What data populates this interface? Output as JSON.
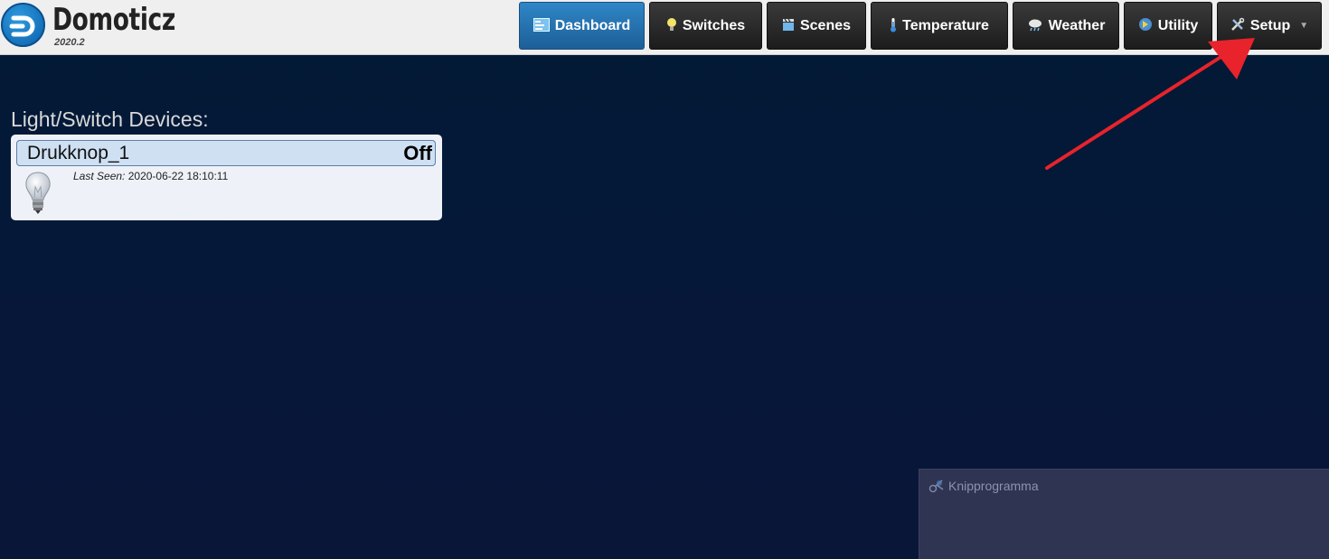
{
  "app": {
    "name": "Domoticz",
    "version": "2020.2"
  },
  "nav": {
    "items": [
      {
        "label": "Dashboard",
        "icon": "dashboard-icon",
        "active": true
      },
      {
        "label": "Switches",
        "icon": "lightbulb-icon",
        "active": false
      },
      {
        "label": "Scenes",
        "icon": "clapperboard-icon",
        "active": false
      },
      {
        "label": "Temperature",
        "icon": "thermometer-icon",
        "active": false
      },
      {
        "label": "Weather",
        "icon": "rain-cloud-icon",
        "active": false
      },
      {
        "label": "Utility",
        "icon": "utility-icon",
        "active": false
      },
      {
        "label": "Setup",
        "icon": "tools-icon",
        "active": false,
        "dropdown": true
      }
    ]
  },
  "content": {
    "section_title": "Light/Switch Devices:",
    "devices": [
      {
        "name": "Drukknop_1",
        "status": "Off",
        "last_seen_label": "Last Seen:",
        "last_seen_value": "2020-06-22 18:10:11",
        "icon": "lightbulb-off-icon"
      }
    ]
  },
  "overlay": {
    "snipping_tool_label": "Knipprogramma"
  },
  "colors": {
    "background": "#021a35",
    "nav_active": "#2f86c6",
    "nav_inactive": "#2a2a2a",
    "card_header": "#cfe0f3",
    "annotation_arrow": "#e8232b"
  }
}
